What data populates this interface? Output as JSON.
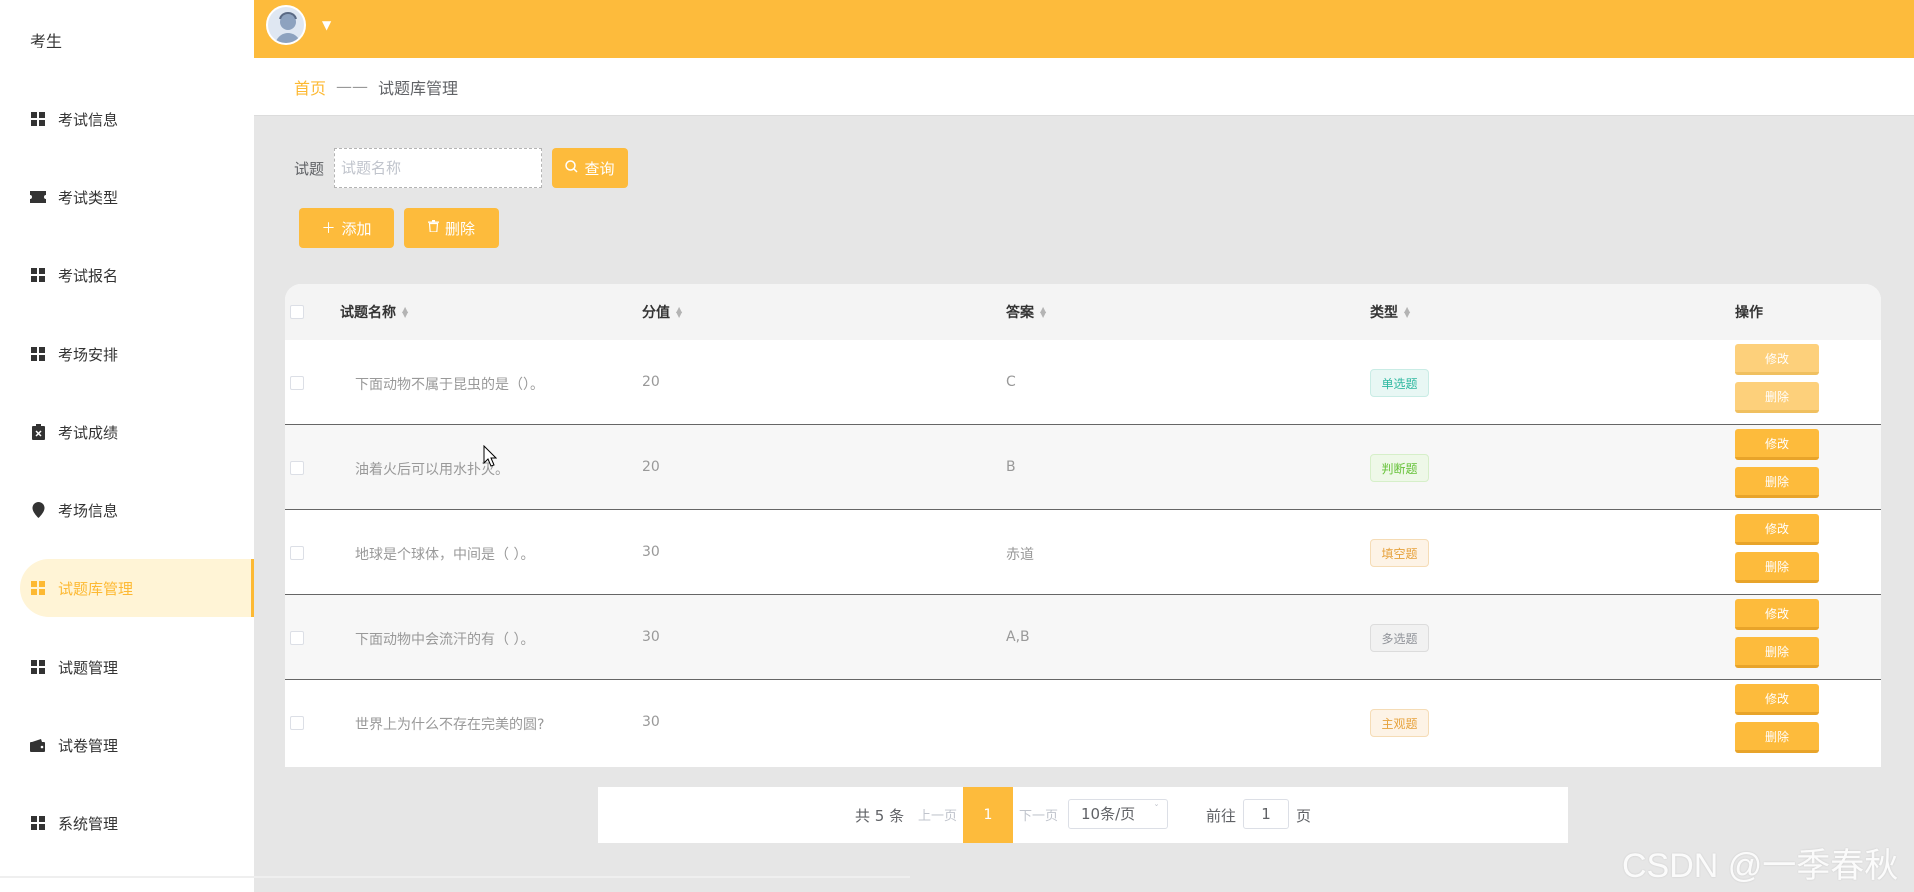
{
  "sidebar": {
    "cut_item": "考生",
    "items": [
      {
        "label": "考试信息",
        "icon": "grid-icon"
      },
      {
        "label": "考试类型",
        "icon": "ticket-icon"
      },
      {
        "label": "考试报名",
        "icon": "grid-icon"
      },
      {
        "label": "考场安排",
        "icon": "grid-icon"
      },
      {
        "label": "考试成绩",
        "icon": "clipboard-icon"
      },
      {
        "label": "考场信息",
        "icon": "location-icon"
      },
      {
        "label": "试题库管理",
        "icon": "grid-icon",
        "active": true
      },
      {
        "label": "试题管理",
        "icon": "grid-icon"
      },
      {
        "label": "试卷管理",
        "icon": "wallet-icon"
      },
      {
        "label": "系统管理",
        "icon": "grid-icon"
      }
    ]
  },
  "header": {
    "avatar": "user-avatar",
    "accent": "#fdbb3c"
  },
  "breadcrumb": {
    "home": "首页",
    "separator": "——",
    "current": "试题库管理"
  },
  "search": {
    "label": "试题",
    "placeholder": "试题名称",
    "query_button": "查询"
  },
  "actions": {
    "add": "添加",
    "delete": "删除"
  },
  "table": {
    "columns": [
      "试题名称",
      "分值",
      "答案",
      "类型",
      "操作"
    ],
    "rows": [
      {
        "name": "下面动物不属于昆虫的是（）。",
        "score": "20",
        "answer": "C",
        "type": "单选题"
      },
      {
        "name": "油着火后可以用水扑灭。",
        "score": "20",
        "answer": "B",
        "type": "判断题"
      },
      {
        "name": "地球是个球体，中间是（ ）。",
        "score": "30",
        "answer": "赤道",
        "type": "填空题"
      },
      {
        "name": "下面动物中会流汗的有（ ）。",
        "score": "30",
        "answer": "A,B",
        "type": "多选题"
      },
      {
        "name": "世界上为什么不存在完美的圆?",
        "score": "30",
        "answer": "",
        "type": "主观题"
      }
    ],
    "edit_label": "修改",
    "delete_label": "删除"
  },
  "pagination": {
    "total": "共 5 条",
    "prev": "上一页",
    "current": "1",
    "next": "下一页",
    "page_size": "10条/页",
    "goto_label": "前往",
    "goto_value": "1",
    "page_suffix": "页"
  },
  "watermark": "CSDN @一季春秋"
}
